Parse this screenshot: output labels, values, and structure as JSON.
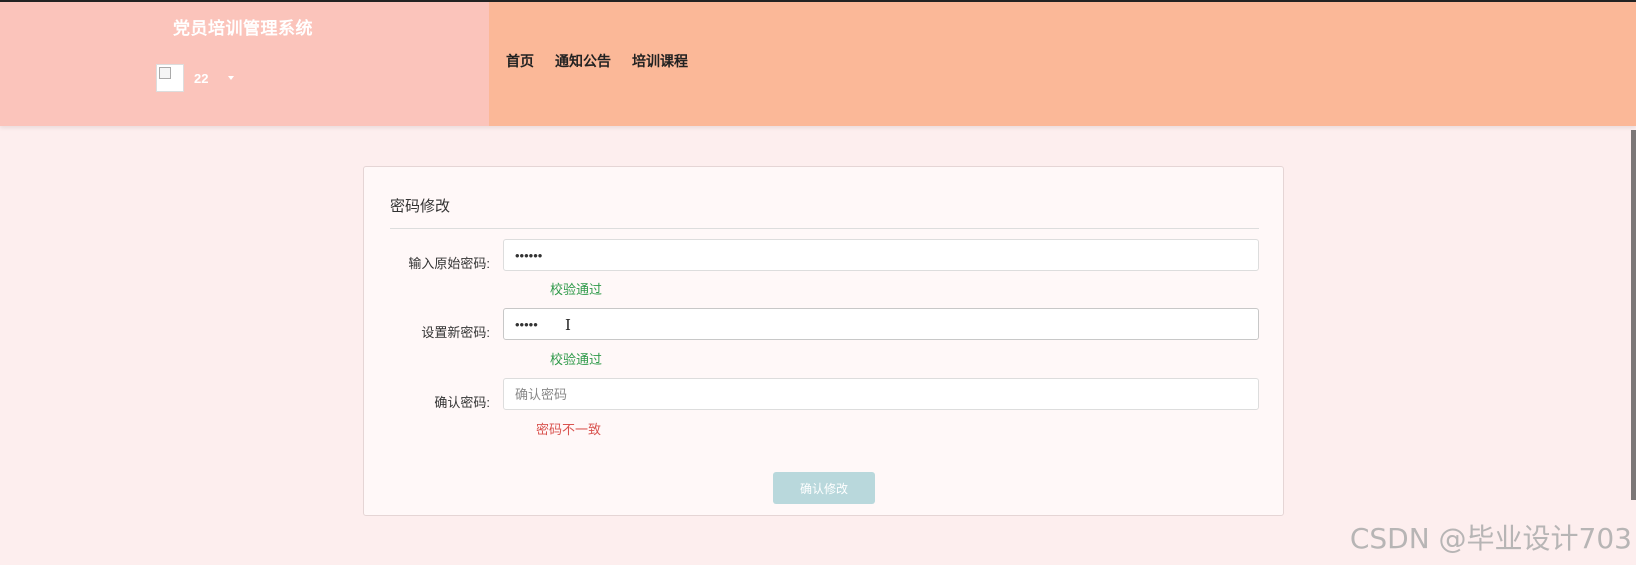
{
  "app": {
    "title": "党员培训管理系统",
    "username": "22"
  },
  "nav": {
    "items": [
      {
        "label": "首页"
      },
      {
        "label": "通知公告"
      },
      {
        "label": "培训课程"
      }
    ]
  },
  "form": {
    "title": "密码修改",
    "fields": [
      {
        "label": "输入原始密码:",
        "value": "••••••",
        "placeholder": "",
        "hint": "校验通过",
        "hint_status": "ok"
      },
      {
        "label": "设置新密码:",
        "value": "•••••",
        "placeholder": "",
        "hint": "校验通过",
        "hint_status": "ok"
      },
      {
        "label": "确认密码:",
        "value": "",
        "placeholder": "确认密码",
        "hint": "密码不一致",
        "hint_status": "bad"
      }
    ],
    "submit_label": "确认修改"
  },
  "watermark": "CSDN @毕业设计703",
  "colors": {
    "brand_bg": "#fbc4bb",
    "nav_bg": "#fbb898",
    "page_bg": "#fdeeee",
    "ok": "#2f9a4a",
    "bad": "#d9534f",
    "submit_bg": "#b9d8dc"
  },
  "icons": {
    "avatar": "broken-image-icon",
    "user_menu": "caret-down-icon",
    "cursor": "text-cursor-icon"
  }
}
